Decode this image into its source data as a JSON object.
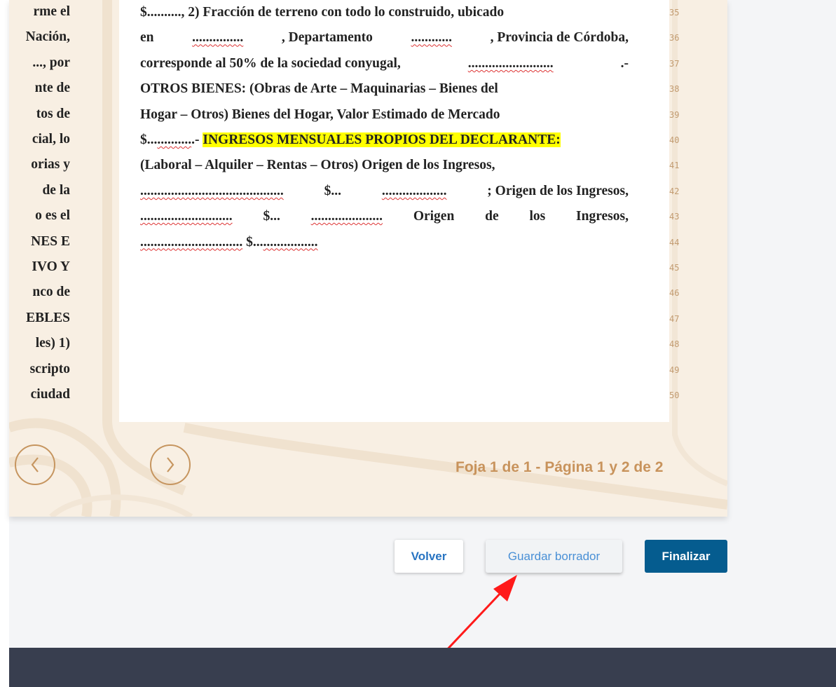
{
  "document": {
    "lines": [
      {
        "num": "35",
        "parts": [
          {
            "t": "$.........., 2) Fracción de terreno con todo lo construido, ubicado",
            "cls": ""
          }
        ]
      },
      {
        "num": "36",
        "parts": [
          {
            "t": "en",
            "cls": ""
          },
          {
            "t": "...............",
            "cls": "dots"
          },
          {
            "t": ", Departamento",
            "cls": ""
          },
          {
            "t": "............",
            "cls": "dots"
          },
          {
            "t": ", Provincia de Córdoba,",
            "cls": ""
          }
        ]
      },
      {
        "num": "37",
        "parts": [
          {
            "t": "corresponde al 50% de la sociedad conyugal,",
            "cls": ""
          },
          {
            "t": ".........................",
            "cls": "dots"
          },
          {
            "t": ".-",
            "cls": ""
          }
        ]
      },
      {
        "num": "38",
        "parts": [
          {
            "t": "OTROS BIENES: (Obras de Arte – Maquinarias – Bienes del",
            "cls": ""
          }
        ]
      },
      {
        "num": "39",
        "parts": [
          {
            "t": "Hogar – Otros) Bienes del Hogar, Valor Estimado de Mercado",
            "cls": ""
          }
        ]
      },
      {
        "num": "40",
        "parts": [
          {
            "t": "$...",
            "cls": ""
          },
          {
            "t": "..........",
            "cls": "dots"
          },
          {
            "t": ".- ",
            "cls": ""
          },
          {
            "t": "INGRESOS MENSUALES PROPIOS DEL DECLARANTE:",
            "cls": "hl"
          }
        ]
      },
      {
        "num": "41",
        "parts": [
          {
            "t": "(Laboral – Alquiler – Rentas – Otros) Origen de los Ingresos,",
            "cls": ""
          }
        ]
      },
      {
        "num": "42",
        "parts": [
          {
            "t": "..........................................",
            "cls": "dots"
          },
          {
            "t": "$...",
            "cls": ""
          },
          {
            "t": "...................",
            "cls": "dots"
          },
          {
            "t": "; Origen de los Ingresos,",
            "cls": ""
          }
        ]
      },
      {
        "num": "43",
        "parts": [
          {
            "t": "...........................",
            "cls": "dots"
          },
          {
            "t": "$...",
            "cls": ""
          },
          {
            "t": ".....................",
            "cls": "dots"
          },
          {
            "t": "Origen",
            "cls": ""
          },
          {
            "t": "de",
            "cls": ""
          },
          {
            "t": "los",
            "cls": ""
          },
          {
            "t": "Ingresos,",
            "cls": ""
          }
        ]
      },
      {
        "num": "44",
        "parts": [
          {
            "t": "..............................",
            "cls": "dots"
          },
          {
            "t": " $...",
            "cls": ""
          },
          {
            "t": "................",
            "cls": "dots"
          }
        ]
      }
    ],
    "empty_line_numbers": [
      "45",
      "46",
      "47",
      "48",
      "49",
      "50"
    ],
    "left_page_fragments": [
      "rme el",
      "Nación,",
      "..., por",
      "nte de",
      "tos de",
      "cial, lo",
      "orias y",
      " de la",
      "o es el",
      "NES  E",
      "IVO  Y",
      "nco de",
      "EBLES",
      "les) 1)",
      "scripto",
      "ciudad"
    ]
  },
  "pager": {
    "foja_label": "Foja 1 de 1 - Página 1 y 2 de 2",
    "prev_glyph": "‹",
    "next_glyph": "›"
  },
  "actions": {
    "volver": "Volver",
    "guardar_borrador": "Guardar borrador",
    "finalizar": "Finalizar"
  },
  "colors": {
    "accent": "#c8935c",
    "primary": "#055c8f",
    "highlight": "#ffff00",
    "annotation_arrow": "#ff1a1a",
    "footer": "#383e4f"
  }
}
